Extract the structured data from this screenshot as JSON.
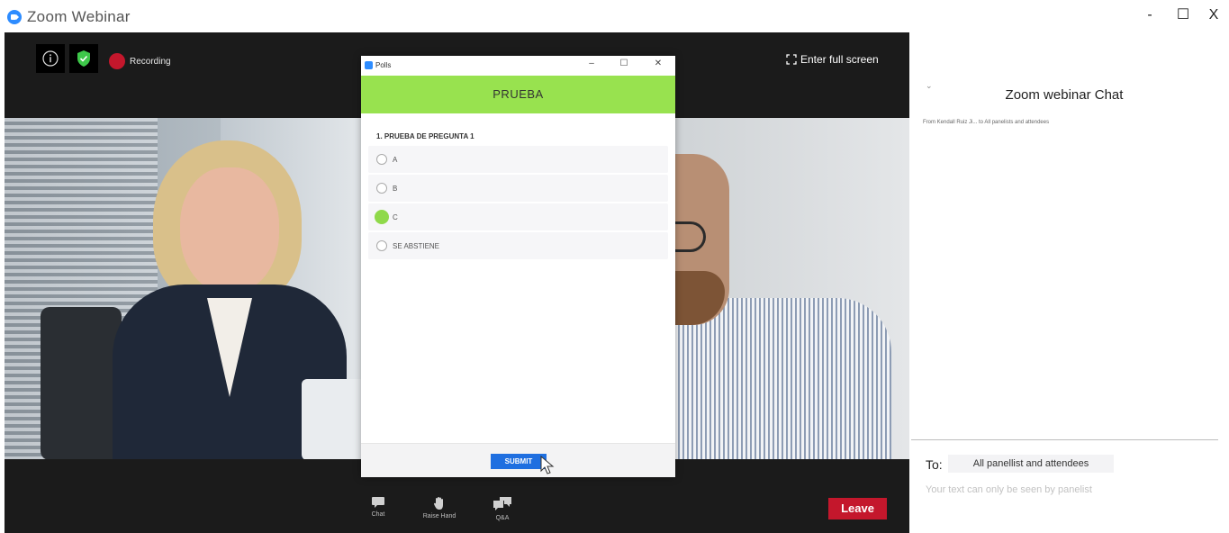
{
  "window": {
    "title": "Zoom Webinar",
    "minimize": "-",
    "maximize": "☐",
    "close": "X"
  },
  "meeting": {
    "recording_label": "Recording",
    "fullscreen_label": "Enter full screen",
    "info_icon": "info-icon",
    "security_icon": "shield-check-icon"
  },
  "toolbar": {
    "chat_label": "Chat",
    "raise_hand_label": "Raise Hand",
    "qa_label": "Q&A",
    "leave_label": "Leave"
  },
  "polls": {
    "window_title": "Polls",
    "minimize": "–",
    "maximize": "☐",
    "close": "✕",
    "header": "PRUEBA",
    "question": "1. PRUEBA DE PREGUNTA 1",
    "options": [
      {
        "label": "A",
        "selected": false
      },
      {
        "label": "B",
        "selected": false
      },
      {
        "label": "C",
        "selected": true
      },
      {
        "label": "SE ABSTIENE",
        "selected": false
      }
    ],
    "submit_label": "SUBMIT"
  },
  "chat": {
    "title": "Zoom webinar Chat",
    "from_line": "From Kendall  Ruiz Ji...  to    All panelists and attendees",
    "to_label": "To:",
    "to_value": "All panellist and attendees",
    "note": "Your text can only be seen by panelist"
  },
  "colors": {
    "accent": "#2d8cff",
    "poll_header": "#98e24f",
    "selected_radio": "#8fd94a",
    "submit": "#1f6fe0",
    "leave": "#c4172c",
    "record": "#c4172c",
    "shield": "#3ec84a"
  }
}
